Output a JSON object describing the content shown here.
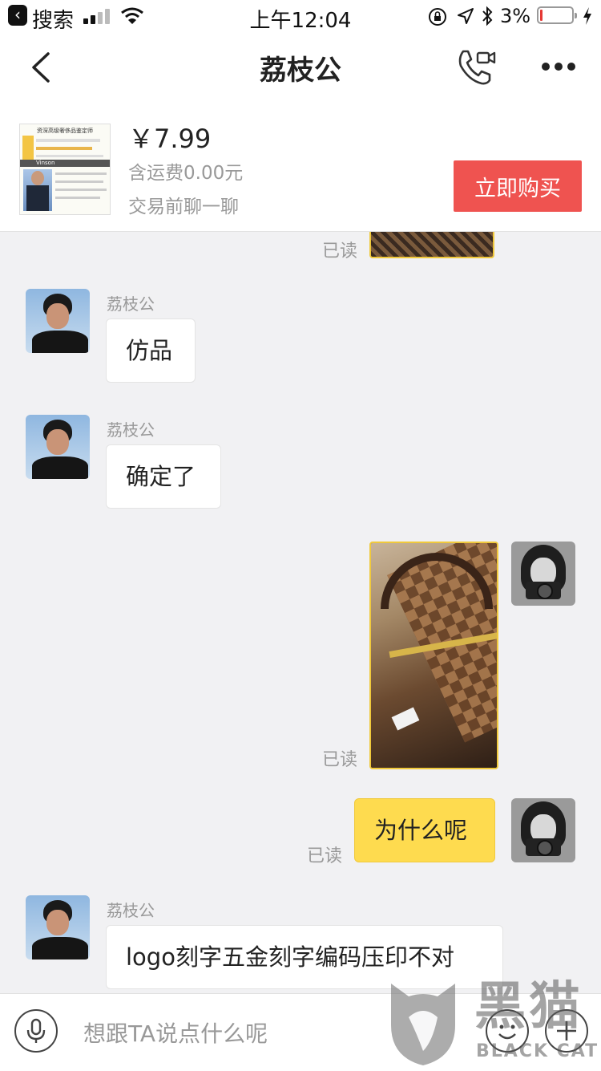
{
  "status_bar": {
    "back_app": "搜索",
    "time": "上午12:04",
    "battery": "3%"
  },
  "nav": {
    "title": "荔枝公"
  },
  "product": {
    "price": "￥7.99",
    "shipping": "含运费0.00元",
    "chat_hint": "交易前聊一聊",
    "buy_label": "立即购买",
    "thumb_heading": "资深高级奢侈品鉴定师",
    "thumb_name": "Vinson"
  },
  "messages": [
    {
      "read": "已读"
    },
    {
      "sender": "荔枝公",
      "text": "仿品"
    },
    {
      "sender": "荔枝公",
      "text": "确定了"
    },
    {
      "read": "已读"
    },
    {
      "text": "为什么呢",
      "read": "已读"
    },
    {
      "sender": "荔枝公",
      "text": "logo刻字五金刻字编码压印不对"
    }
  ],
  "input": {
    "placeholder": "想跟TA说点什么呢"
  },
  "watermark": {
    "cn": "黑猫",
    "en": "BLACK CAT"
  },
  "colors": {
    "buy_button": "#ef5350",
    "my_bubble": "#fedb4f",
    "background": "#f1f1f3"
  }
}
